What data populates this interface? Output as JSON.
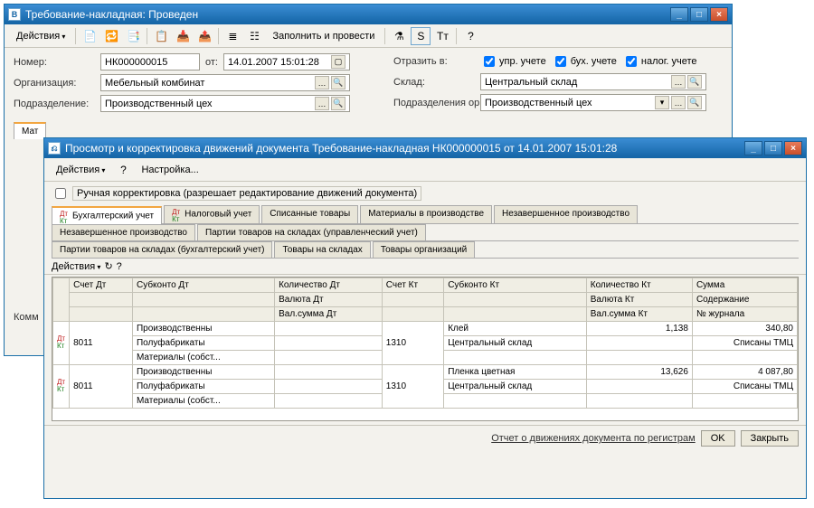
{
  "win1": {
    "title": "Требование-накладная: Проведен",
    "toolbar": {
      "actions": "Действия",
      "fill_post": "Заполнить и провести"
    },
    "form": {
      "number_lbl": "Номер:",
      "number": "НК000000015",
      "ot_lbl": "от:",
      "date": "14.01.2007 15:01:28",
      "org_lbl": "Организация:",
      "org": "Мебельный комбинат",
      "pod_lbl": "Подразделение:",
      "pod": "Производственный цех",
      "refl_lbl": "Отразить в:",
      "chk_upr": "упр. учете",
      "chk_buh": "бух. учете",
      "chk_nal": "налог. учете",
      "sklad_lbl": "Склад:",
      "sklad": "Центральный склад",
      "podorg_lbl": "Подразделения организации:",
      "podorg": "Производственный цех"
    },
    "komm_lbl": "Комм"
  },
  "win2": {
    "title": "Просмотр и корректировка движений документа Требование-накладная НК000000015 от 14.01.2007 15:01:28",
    "toolbar": {
      "actions": "Действия",
      "settings": "Настройка..."
    },
    "manual_chk": "Ручная корректировка (разрешает редактирование движений документа)",
    "tabs_row1": [
      "Бухгалтерский учет",
      "Налоговый учет",
      "Списанные товары",
      "Материалы в производстве",
      "Незавершенное производство"
    ],
    "tabs_row2": [
      "Незавершенное производство",
      "Партии товаров на складах (управленческий учет)"
    ],
    "tabs_row3": [
      "Партии товаров на складах (бухгалтерский учет)",
      "Товары на складах",
      "Товары организаций"
    ],
    "sub_actions": "Действия",
    "headers": {
      "schet_dt": "Счет Дт",
      "subk_dt": "Субконто Дт",
      "kol_dt": "Количество Дт",
      "schet_kt": "Счет Кт",
      "subk_kt": "Субконто Кт",
      "kol_kt": "Количество Кт",
      "summa": "Сумма",
      "val_dt": "Валюта Дт",
      "valsum_dt": "Вал.сумма Дт",
      "val_kt": "Валюта Кт",
      "valsum_kt": "Вал.сумма Кт",
      "sod": "Содержание",
      "jur": "№ журнала"
    },
    "rows": [
      {
        "schet_dt": "8011",
        "sub_dt_1": "Производственны",
        "sub_dt_2": "Полуфабрикаты",
        "sub_dt_3": "Материалы (собст...",
        "schet_kt": "1310",
        "sub_kt_1": "Клей",
        "sub_kt_2": "Центральный склад",
        "kol_kt": "1,138",
        "summa": "340,80",
        "sod": "Списаны ТМЦ"
      },
      {
        "schet_dt": "8011",
        "sub_dt_1": "Производственны",
        "sub_dt_2": "Полуфабрикаты",
        "sub_dt_3": "Материалы (собст...",
        "schet_kt": "1310",
        "sub_kt_1": "Пленка цветная",
        "sub_kt_2": "Центральный склад",
        "kol_kt": "13,626",
        "summa": "4 087,80",
        "sod": "Списаны ТМЦ"
      }
    ],
    "footer": {
      "link": "Отчет о движениях документа по регистрам",
      "ok": "OK",
      "close": "Закрыть"
    }
  }
}
